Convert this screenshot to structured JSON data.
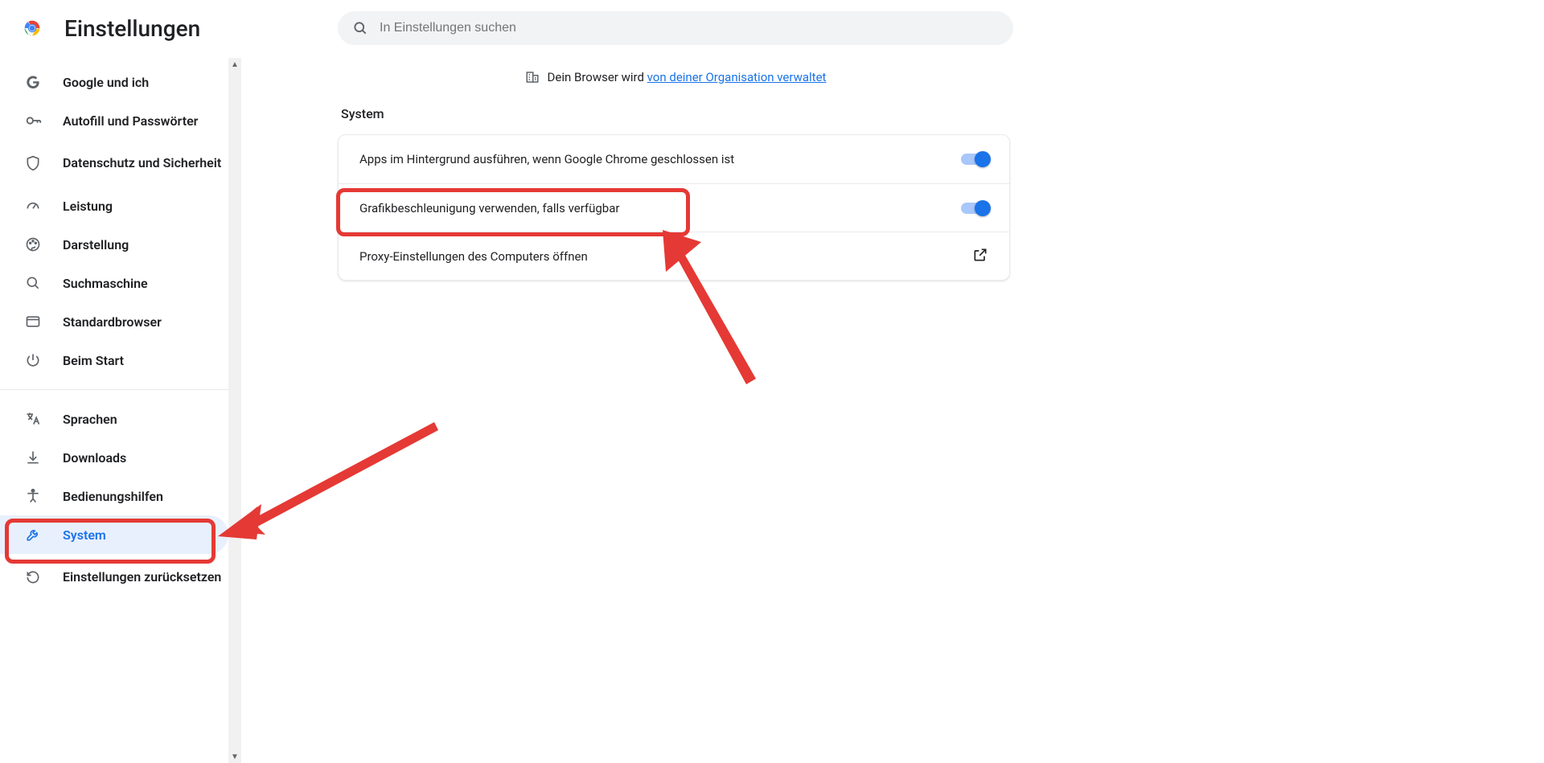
{
  "header": {
    "title": "Einstellungen",
    "search_placeholder": "In Einstellungen suchen"
  },
  "org_banner": {
    "prefix": "Dein Browser wird ",
    "link": "von deiner Organisation verwaltet"
  },
  "section_title": "System",
  "rows": {
    "bg_apps": "Apps im Hintergrund ausführen, wenn Google Chrome geschlossen ist",
    "gpu": "Grafikbeschleunigung verwenden, falls verfügbar",
    "proxy": "Proxy-Einstellungen des Computers öffnen"
  },
  "sidebar": {
    "items": [
      {
        "label": "Google und ich"
      },
      {
        "label": "Autofill und Passwörter"
      },
      {
        "label": "Datenschutz und Sicherheit"
      },
      {
        "label": "Leistung"
      },
      {
        "label": "Darstellung"
      },
      {
        "label": "Suchmaschine"
      },
      {
        "label": "Standardbrowser"
      },
      {
        "label": "Beim Start"
      }
    ],
    "items2": [
      {
        "label": "Sprachen"
      },
      {
        "label": "Downloads"
      },
      {
        "label": "Bedienungshilfen"
      },
      {
        "label": "System"
      },
      {
        "label": "Einstellungen zurücksetzen"
      }
    ]
  }
}
